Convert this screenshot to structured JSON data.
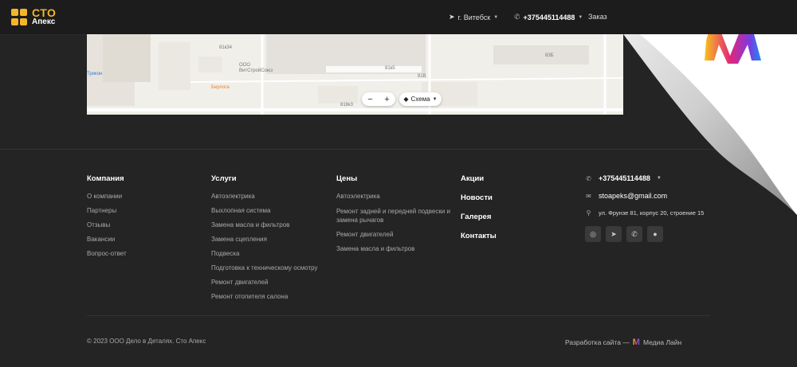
{
  "header": {
    "logo": {
      "line1": "СТО",
      "line2": "Апекс"
    },
    "city": "г. Витебск",
    "phone": "+375445114488",
    "order_label": "Заказ"
  },
  "map": {
    "labels": {
      "b1": "81к34",
      "b2": "81к5",
      "b3": "81В",
      "b4": "818к3",
      "b5": "83Б",
      "poi1": "ООО",
      "poi2": "ВитСтройСоюз",
      "poi3": "Берлога",
      "poi4": "Трикон"
    },
    "zoom_minus": "−",
    "zoom_plus": "+",
    "scheme_label": "Схема"
  },
  "footer": {
    "company": {
      "title": "Компания",
      "links": [
        "О компании",
        "Партнеры",
        "Отзывы",
        "Вакансии",
        "Вопрос-ответ"
      ]
    },
    "services": {
      "title": "Услуги",
      "links": [
        "Автоэлектрика",
        "Выхлопная система",
        "Замена масла и фильтров",
        "Замена сцепления",
        "Подвеска",
        "Подготовка к техническому осмотру",
        "Ремонт двигателей",
        "Ремонт отопителя салона"
      ]
    },
    "prices": {
      "title": "Цены",
      "links": [
        "Автоэлектрика",
        "Ремонт задней и передней подвески и замена рычагов",
        "Ремонт двигателей",
        "Замена масла и фильтров"
      ]
    },
    "plain": [
      "Акции",
      "Новости",
      "Галерея",
      "Контакты"
    ],
    "contacts": {
      "phone": "+375445114488",
      "email": "stoapeks@gmail.com",
      "address": "ул. Фрунзе 81, корпус 20, строение 15"
    },
    "copyright": "© 2023 ООО Дело в Деталях. Сто Апекс",
    "developer_prefix": "Разработка сайта —",
    "developer_name": "Медиа Лайн"
  },
  "colors": {
    "accent": "#f3b52a",
    "background": "#242424"
  },
  "icons": [
    "location-icon",
    "phone-icon",
    "email-icon",
    "instagram-icon",
    "telegram-icon",
    "viber-icon",
    "whatsapp-icon",
    "layers-icon"
  ]
}
